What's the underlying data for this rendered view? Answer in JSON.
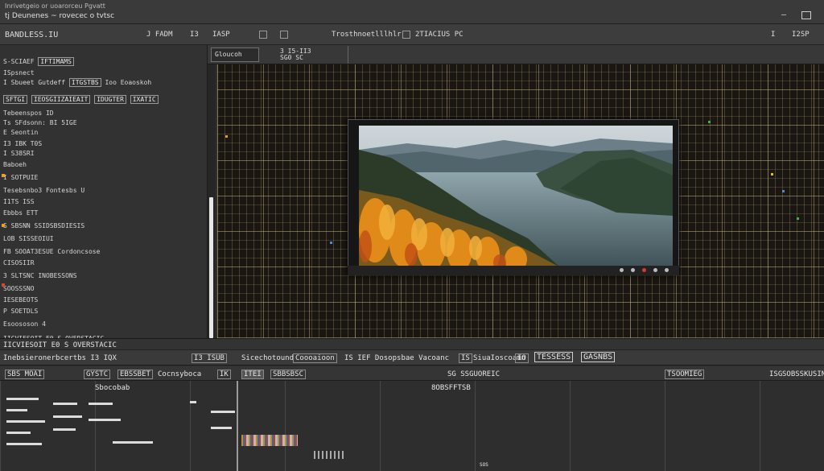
{
  "window": {
    "title": "Inrivetgeio or uoarorceu Pgvatt",
    "subtitle": "tj Deunenes ~ rovecec o tvtsc",
    "controls": [
      "–",
      "□"
    ]
  },
  "toolbar": {
    "left_label": "BANDLESS.IU",
    "items": [
      "J FADM",
      "I3",
      "IASP",
      "I",
      "I",
      "Trosthnoetlllhlr",
      "I",
      "2TIACIUS PC",
      "5TU"
    ],
    "right_items": [
      "I",
      "I2SP",
      "I"
    ]
  },
  "left_panel": {
    "lines": [
      {
        "text": "S-SCIAEF",
        "boxed": "IFTIMAMS"
      },
      {
        "text": "ISpsnect"
      },
      {
        "text": "I Sbueet Gutdeff",
        "boxed": "ITGSTBS",
        "extra": "Ioo    Eoaoskoh"
      },
      {
        "text": "SFTGI",
        "boxed": "IEOSGIIZAIEAIT",
        "extra2": "IDUGTER",
        "extra3": "IXATIC"
      },
      {
        "text": "Tebeenspos ID"
      },
      {
        "text": "Ts SFdsonn:   BI  5IGE"
      },
      {
        "text": "E Seontin"
      },
      {
        "text": "I3 IBK T0S"
      },
      {
        "text": "I S38SRI"
      },
      {
        "text": "Baboeh"
      },
      {
        "text": "I SOTPUIE"
      },
      {
        "text": "Tesebsnbo3            Fontesbs U"
      },
      {
        "text": "I1TS ISS"
      },
      {
        "text": "Ebbbs ETT"
      },
      {
        "text": "S SBSNN  SSIDSBSDIESIS"
      },
      {
        "text": "LOB SISSEOIUI"
      },
      {
        "text": "FB SOOAT3ESUE     Cordoncsose"
      },
      {
        "text": "CISOSIIR"
      },
      {
        "text": "3 SLTSNC  INOBESSONS"
      },
      {
        "text": "SOOSSSNO"
      },
      {
        "text": "IESEBEOTS"
      },
      {
        "text": "P SOETDLS"
      },
      {
        "text": "Esoososon     4"
      }
    ],
    "footer": "IICVIESOIT E0    S OVERSTACIC"
  },
  "viewport": {
    "tab_label": "Gloucoh",
    "tab_extra": "3 I5-II3\nSG0 SC"
  },
  "status_row1": {
    "left": "Inebsieronerbcertbs I3 IQX",
    "mid1": "I3 ISUB",
    "mid2": "Sicechotound",
    "mid3": "Coooaioon",
    "mid4": "IS IEF Dosopsbae Vacoanc",
    "mid5": "IS",
    "mid6": "SiuaIoscoamn",
    "mid7": "IO",
    "right1": "TESSESS",
    "right2": "GASNBS"
  },
  "status_row2": {
    "left1": "SBS MOAI",
    "left2": "GYSTC",
    "left3": "EBSSBET",
    "left4": "Cocnsyboca",
    "left5": "IK",
    "left6": "ITEI",
    "left7": "SBBSBSC",
    "mid1": "SG SSGUOREIC",
    "right1": "TSOOMIEG",
    "right2": "ISG",
    "right3": "SOBSSKUSIN"
  },
  "bottom": {
    "header1": "Sbocobab",
    "header2": "8OBSFFTSB",
    "footer": "SOS"
  }
}
